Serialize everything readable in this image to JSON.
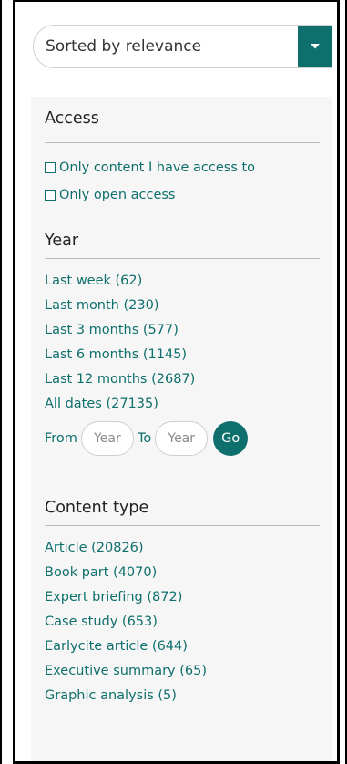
{
  "sort": {
    "label": "Sorted by relevance"
  },
  "access": {
    "title": "Access",
    "options": [
      {
        "label": "Only content I have access to",
        "checked": false
      },
      {
        "label": "Only open access",
        "checked": false
      }
    ]
  },
  "year": {
    "title": "Year",
    "links": [
      "Last week (62)",
      "Last month (230)",
      "Last 3 months (577)",
      "Last 6 months (1145)",
      "Last 12 months (2687)",
      "All dates (27135)"
    ],
    "from_label": "From",
    "to_label": "To",
    "from_placeholder": "Year",
    "to_placeholder": "Year",
    "go_label": "Go"
  },
  "content_type": {
    "title": "Content type",
    "links": [
      "Article (20826)",
      "Book part (4070)",
      "Expert briefing (872)",
      "Case study (653)",
      "Earlycite article (644)",
      "Executive summary (65)",
      "Graphic analysis (5)"
    ]
  },
  "colors": {
    "accent": "#0e6f6c",
    "panel_bg": "#f6f6f6"
  }
}
